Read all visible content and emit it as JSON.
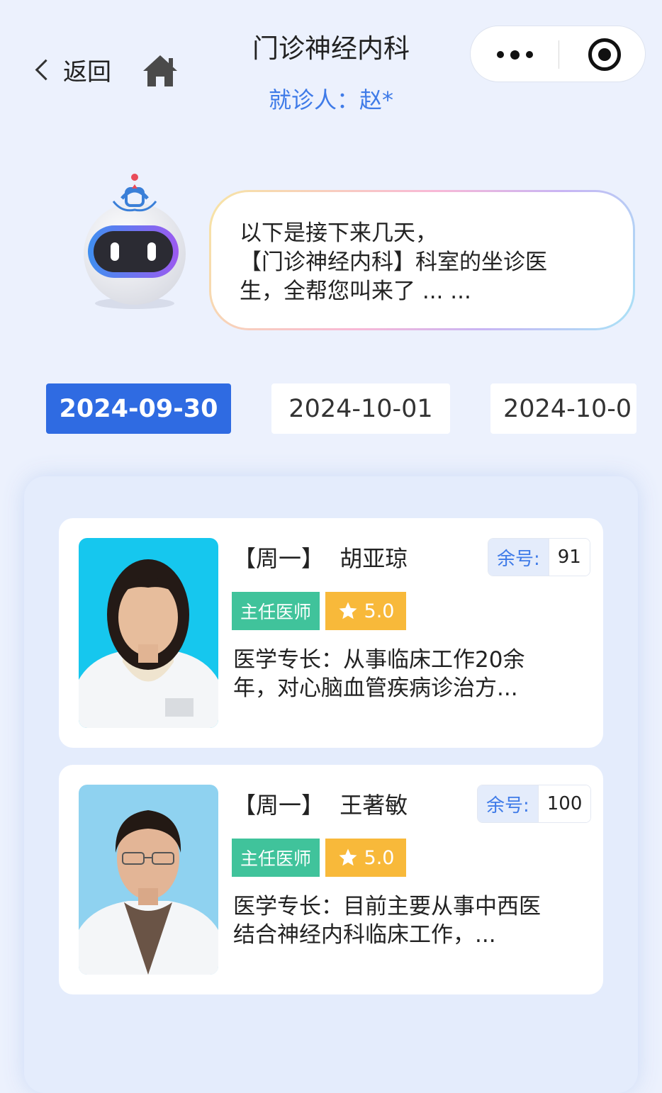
{
  "header": {
    "back_label": "返回",
    "title": "门诊神经内科",
    "patient": "就诊人：赵*"
  },
  "bubble": {
    "line1": "以下是接下来几天，",
    "line2": "【门诊神经内科】科室的坐诊医",
    "line3": "生，全帮您叫来了 ... ..."
  },
  "dates": [
    "2024-09-30",
    "2024-10-01",
    "2024-10-0"
  ],
  "doctors": [
    {
      "weekday": "【周一】",
      "name": "胡亚琼",
      "remain_label": "余号:",
      "remain_value": "91",
      "title": "主任医师",
      "rating": "5.0",
      "specialty": "医学专长：从事临床工作20余年，对心脑血管疾病诊治方..."
    },
    {
      "weekday": "【周一】",
      "name": "王著敏",
      "remain_label": "余号:",
      "remain_value": "100",
      "title": "主任医师",
      "rating": "5.0",
      "specialty": "医学专长：目前主要从事中西医结合神经内科临床工作，..."
    }
  ],
  "colors": {
    "accent": "#2f6be2",
    "title_badge": "#40c39b",
    "rating_badge": "#f8b93a",
    "remain_label": "#3f7be8"
  }
}
